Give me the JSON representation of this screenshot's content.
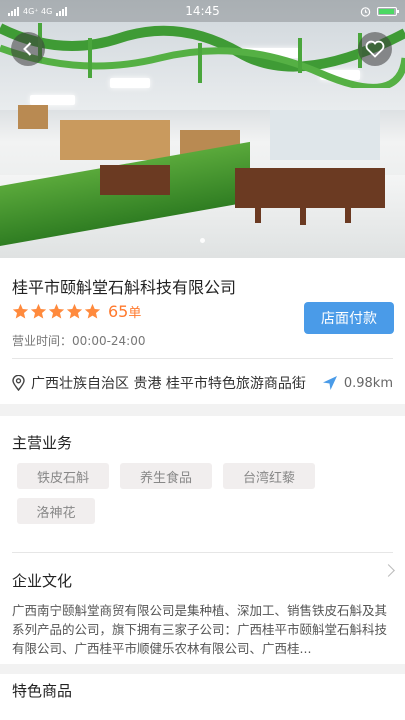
{
  "status_bar": {
    "network": "4G⁺ 4G",
    "time": "14:45"
  },
  "hero": {
    "page_indicator_count": 1
  },
  "shop": {
    "name": "桂平市颐斛堂石斛科技有限公司",
    "rating_stars": 5,
    "orders_count": "65",
    "orders_unit": "单",
    "hours": "营业时间：00:00-24:00",
    "pay_label": "店面付款"
  },
  "location": {
    "address": "广西壮族自治区 贵港 桂平市特色旅游商品街",
    "distance": "0.98km"
  },
  "business": {
    "title": "主营业务",
    "tags": [
      "铁皮石斛",
      "养生食品",
      "台湾红藜",
      "洛神花"
    ]
  },
  "culture": {
    "title": "企业文化",
    "text": "广西南宁颐斛堂商贸有限公司是集种植、深加工、销售铁皮石斛及其系列产品的公司，旗下拥有三家子公司：广西桂平市颐斛堂石斛科技有限公司、广西桂平市顺健乐农林有限公司、广西桂..."
  },
  "featured": {
    "title": "特色商品"
  },
  "colors": {
    "accent_blue": "#4a9be8",
    "star_orange": "#ff8a3d",
    "orders_orange": "#ff7a2e",
    "tag_bg": "#f1eeee"
  },
  "icons": {
    "back": "back-arrow-icon",
    "favorite": "heart-icon",
    "location": "location-pin-icon",
    "navigate": "navigation-arrow-icon",
    "more": "chevron-right-icon"
  }
}
